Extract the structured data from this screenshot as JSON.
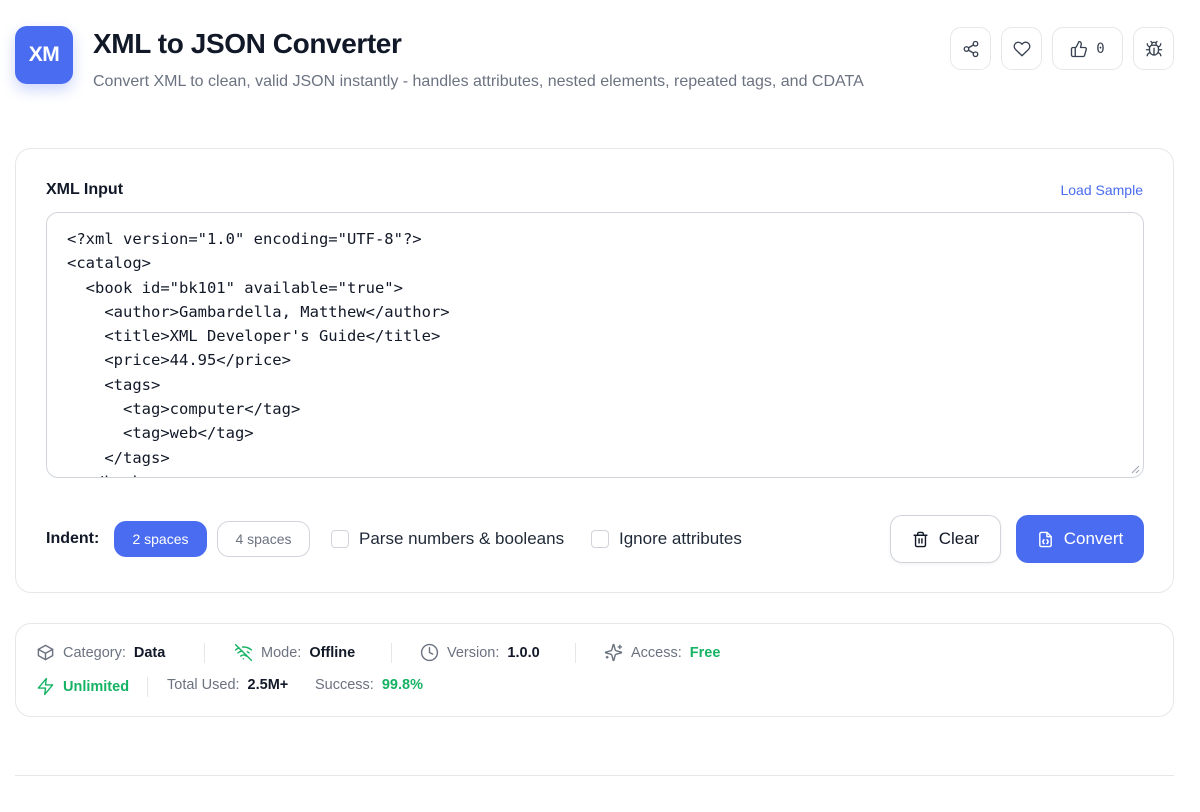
{
  "header": {
    "logo_text": "XM",
    "title": "XML to JSON Converter",
    "subtitle": "Convert XML to clean, valid JSON instantly - handles attributes, nested elements, repeated tags, and CDATA",
    "like_count": "0",
    "icons": [
      "share-icon",
      "heart-icon",
      "thumbs-up-icon",
      "bug-icon"
    ]
  },
  "input": {
    "label": "XML Input",
    "load_sample": "Load Sample",
    "value": "<?xml version=\"1.0\" encoding=\"UTF-8\"?>\n<catalog>\n  <book id=\"bk101\" available=\"true\">\n    <author>Gambardella, Matthew</author>\n    <title>XML Developer's Guide</title>\n    <price>44.95</price>\n    <tags>\n      <tag>computer</tag>\n      <tag>web</tag>\n    </tags>\n  </book>"
  },
  "options": {
    "indent_label": "Indent:",
    "indent_2": "2 spaces",
    "indent_4": "4 spaces",
    "indent_selected": "2 spaces",
    "parse_label": "Parse numbers & booleans",
    "ignore_attrs_label": "Ignore attributes",
    "parse_checked": false,
    "ignore_attrs_checked": false
  },
  "actions": {
    "clear": "Clear",
    "convert": "Convert"
  },
  "info": {
    "category_label": "Category:",
    "category_value": "Data",
    "mode_label": "Mode:",
    "mode_value": "Offline",
    "version_label": "Version:",
    "version_value": "1.0.0",
    "access_label": "Access:",
    "access_value": "Free",
    "unlimited": "Unlimited",
    "total_used_label": "Total Used:",
    "total_used_value": "2.5M+",
    "success_label": "Success:",
    "success_value": "99.8%"
  },
  "colors": {
    "accent": "#4a6cf0",
    "success": "#16b364"
  }
}
